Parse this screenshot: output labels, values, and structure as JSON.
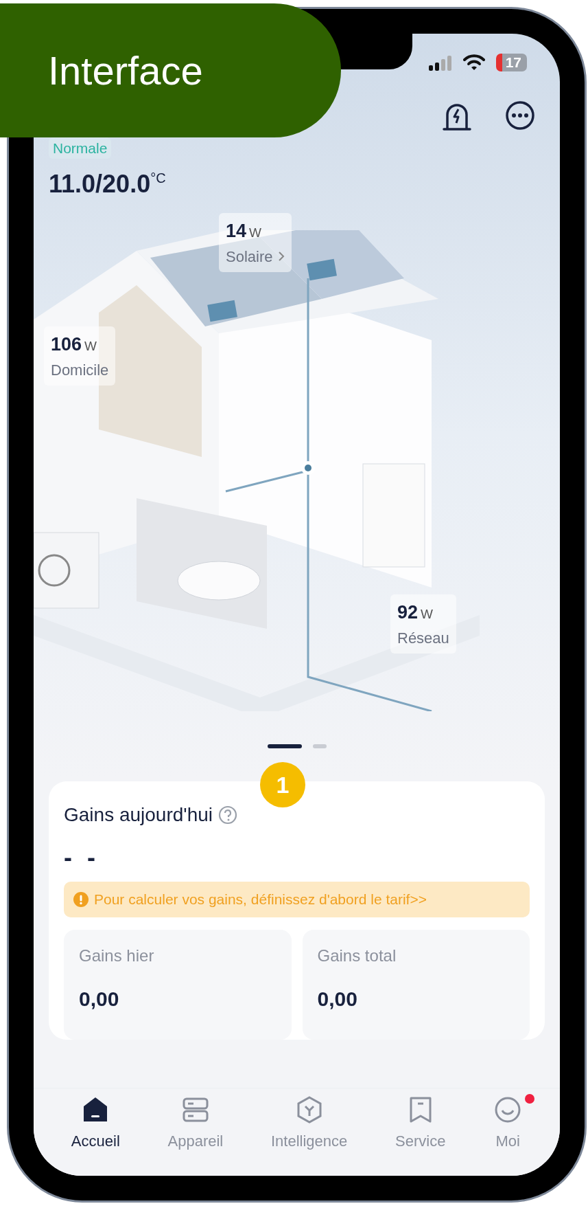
{
  "overlay_label": "Interface",
  "status_bar": {
    "battery": "17"
  },
  "mode": "Normale",
  "temperature": {
    "value": "11.0/20.0",
    "unit": "°C"
  },
  "flows": [
    {
      "value": "14",
      "unit": "W",
      "label": "Solaire",
      "link": true
    },
    {
      "value": "106",
      "unit": "W",
      "label": "Domicile",
      "link": false
    },
    {
      "value": "92",
      "unit": "W",
      "label": "Réseau",
      "link": false
    }
  ],
  "pager": [
    {
      "selected": true
    },
    {
      "selected": false
    }
  ],
  "callout": "1",
  "earnings": {
    "title": "Gains aujourd'hui",
    "value": "- -",
    "warning": "Pour calculer vos gains, définissez d'abord le tarif>>",
    "stats": [
      {
        "label": "Gains hier",
        "value": "0,00"
      },
      {
        "label": "Gains total",
        "value": "0,00"
      }
    ]
  },
  "tabs": [
    {
      "label": "Accueil",
      "selected": true,
      "notification": false
    },
    {
      "label": "Appareil",
      "selected": false,
      "notification": false
    },
    {
      "label": "Intelligence",
      "selected": false,
      "notification": false
    },
    {
      "label": "Service",
      "selected": false,
      "notification": false
    },
    {
      "label": "Moi",
      "selected": false,
      "notification": true
    }
  ]
}
